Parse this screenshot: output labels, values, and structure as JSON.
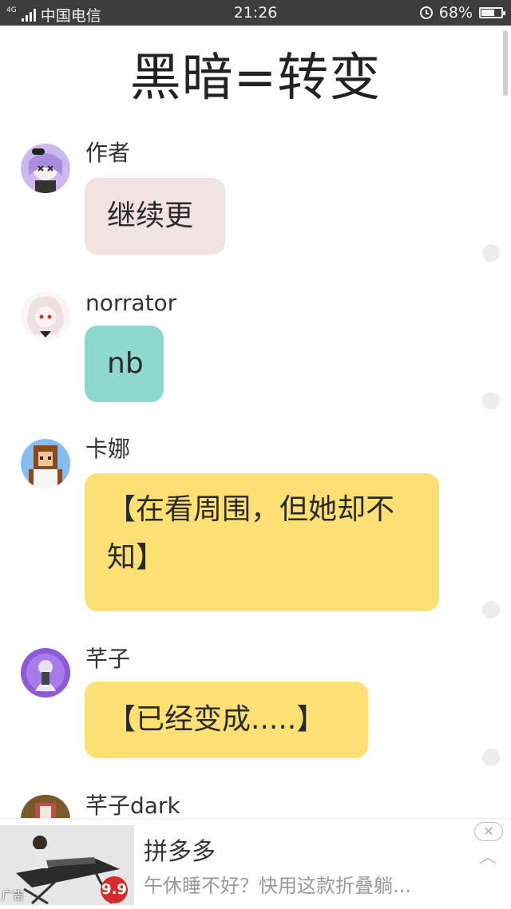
{
  "status_bar": {
    "network": "4G",
    "carrier": "中国电信",
    "time": "21:26",
    "battery": "68%",
    "battery_level": 0.68
  },
  "title": "黑暗=转变",
  "messages": [
    {
      "sender": "作者",
      "text": "继续更",
      "bubble_color": "#f2e3e3",
      "avatar_color": "#b9a6e6"
    },
    {
      "sender": "norrator",
      "text": "nb",
      "bubble_color": "#8fd8ce",
      "avatar_color": "#f3e6e6"
    },
    {
      "sender": "卡娜",
      "text": "【在看周围，但她却不知】",
      "bubble_color": "#fde073",
      "avatar_color": "#7fb6e8"
    },
    {
      "sender": "芊子",
      "text": "【已经变成.....】",
      "bubble_color": "#fde073",
      "avatar_color": "#9a6be0"
    },
    {
      "sender": "芊子dark",
      "text": "",
      "bubble_color": "#fde073",
      "avatar_color": "#7a5a2a"
    }
  ],
  "ad": {
    "title": "拼多多",
    "description": "午休睡不好？快用这款折叠躺...",
    "label": "广告",
    "price": "9.9",
    "close_icon": "close-icon"
  }
}
